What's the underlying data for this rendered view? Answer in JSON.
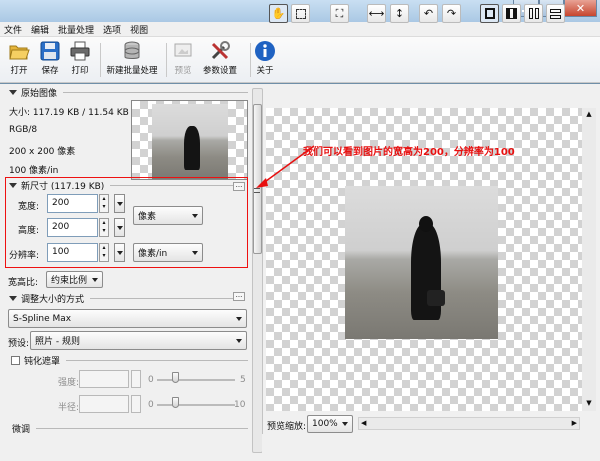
{
  "menu": [
    "文件",
    "编辑",
    "批量处理",
    "选项",
    "视图"
  ],
  "toolbar": {
    "open": "打开",
    "save": "保存",
    "print": "打印",
    "batch": "新建批量处理",
    "preview": "预览",
    "params": "参数设置",
    "about": "关于"
  },
  "original": {
    "header": "原始图像",
    "size": "大小: 117.19 KB / 11.54 KB",
    "mode": "RGB/8",
    "dims": "200 x 200 像素",
    "res": "100 像素/in"
  },
  "newsize": {
    "header": "新尺寸 (117.19 KB)",
    "width_label": "宽度:",
    "width_value": "200",
    "height_label": "高度:",
    "height_value": "200",
    "res_label": "分辨率:",
    "res_value": "100",
    "unit": "像素",
    "res_unit": "像素/in",
    "ratio_label": "宽高比:",
    "ratio_value": "约束比例"
  },
  "resize": {
    "header": "调整大小的方式",
    "method": "S-Spline Max",
    "preset_label": "预设:",
    "preset_value": "照片 - 规则"
  },
  "sharpen": {
    "label": "钝化遮罩",
    "strength_label": "强度:",
    "strength_min": "0",
    "strength_max": "5",
    "radius_label": "半径:",
    "radius_min": "0",
    "radius_max": "10"
  },
  "finetune": {
    "label": "微调"
  },
  "annotation": "我们可以看到图片的宽高为200，分辨率为100",
  "zoom": {
    "label": "预览缩放:",
    "value": "100%"
  },
  "colors": {
    "annotation": "#e81010",
    "accent": "#1f62c2"
  }
}
